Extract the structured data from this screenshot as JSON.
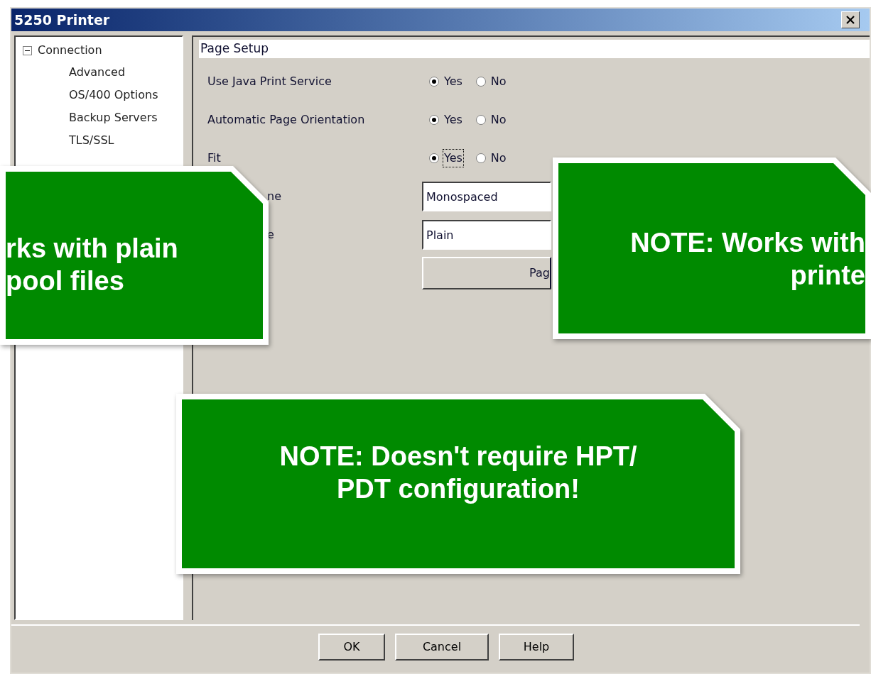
{
  "window": {
    "title": "5250 Printer"
  },
  "tree": [
    {
      "label": "Connection",
      "expanded": true,
      "children": [
        {
          "label": "Advanced"
        },
        {
          "label": "OS/400 Options"
        },
        {
          "label": "Backup Servers"
        },
        {
          "label": "TLS/SSL"
        }
      ]
    }
  ],
  "panel": {
    "title": "Page Setup",
    "rows": [
      {
        "kind": "radio",
        "label": "Use Java Print Service",
        "options": [
          {
            "label": "Yes",
            "selected": true,
            "focused": false
          },
          {
            "label": "No",
            "selected": false,
            "focused": false
          }
        ]
      },
      {
        "kind": "radio",
        "label": "Automatic Page Orientation",
        "options": [
          {
            "label": "Yes",
            "selected": true,
            "focused": false
          },
          {
            "label": "No",
            "selected": false,
            "focused": false
          }
        ]
      },
      {
        "kind": "radio",
        "label": "Fit",
        "options": [
          {
            "label": "Yes",
            "selected": true,
            "focused": true
          },
          {
            "label": "No",
            "selected": false,
            "focused": false
          }
        ]
      },
      {
        "kind": "field",
        "label": "ne",
        "value": "Monospaced"
      },
      {
        "kind": "field",
        "label": "e",
        "value": "Plain"
      },
      {
        "kind": "button",
        "label": "Pag"
      }
    ]
  },
  "buttons": [
    "OK",
    "Cancel",
    "Help"
  ],
  "callouts": [
    {
      "kind": "left",
      "text": "rks with plain\npool files"
    },
    {
      "kind": "right",
      "text": "NOTE: Works with\nprinte"
    },
    {
      "kind": "center",
      "text": "NOTE: Doesn't require HPT/\nPDT configuration!"
    }
  ]
}
